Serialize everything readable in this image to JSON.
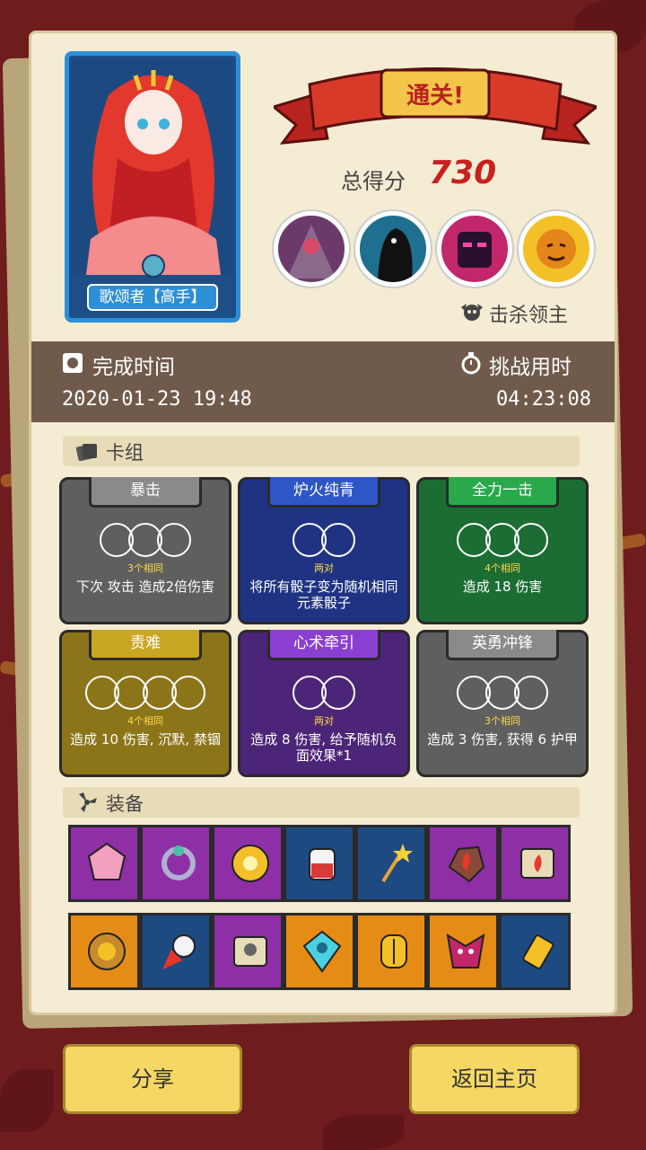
{
  "hero": {
    "name": "歌颂者【高手】"
  },
  "banner": {
    "title": "通关!"
  },
  "score": {
    "label": "总得分",
    "value": "730"
  },
  "bosses": {
    "label": "击杀领主"
  },
  "time": {
    "completed_label": "完成时间",
    "completed_value": "2020-01-23 19:48",
    "duration_label": "挑战用时",
    "duration_value": "04:23:08"
  },
  "deck": {
    "title": "卡组",
    "cards": [
      {
        "name": "暴击",
        "sub": "3个相同",
        "desc": "下次 攻击 造成2倍伤害",
        "color": "#5f5f5f",
        "tab": "#8a8a8a",
        "dice": 3
      },
      {
        "name": "炉火纯青",
        "sub": "两对",
        "desc": "将所有骰子变为随机相同元素骰子",
        "color": "#1f3382",
        "tab": "#2f56c6",
        "dice": 2
      },
      {
        "name": "全力一击",
        "sub": "4个相同",
        "desc": "造成 18 伤害",
        "color": "#1b6d34",
        "tab": "#29a84c",
        "dice": 3
      },
      {
        "name": "责难",
        "sub": "4个相同",
        "desc": "造成 10 伤害, 沉默, 禁锢",
        "color": "#8c7519",
        "tab": "#c9a623",
        "dice": 4
      },
      {
        "name": "心术牵引",
        "sub": "两对",
        "desc": "造成 8 伤害, 给予随机负面效果*1",
        "color": "#4c2578",
        "tab": "#8a3fd0",
        "dice": 2
      },
      {
        "name": "英勇冲锋",
        "sub": "3个相同",
        "desc": "造成 3 伤害, 获得 6 护甲",
        "color": "#5f5f5f",
        "tab": "#8a8a8a",
        "dice": 3
      }
    ]
  },
  "equipment": {
    "title": "装备",
    "row1": [
      {
        "icon": "gem-icon",
        "bg": "#8e2fa6"
      },
      {
        "icon": "ring-icon",
        "bg": "#8e2fa6"
      },
      {
        "icon": "gold-medallion-icon",
        "bg": "#8e2fa6"
      },
      {
        "icon": "potion-jar-icon",
        "bg": "#1e4a82"
      },
      {
        "icon": "star-wand-icon",
        "bg": "#1e4a82"
      },
      {
        "icon": "fire-rock-icon",
        "bg": "#8e2fa6"
      },
      {
        "icon": "fire-scroll-icon",
        "bg": "#8e2fa6"
      }
    ],
    "row2": [
      {
        "icon": "lion-ring-icon",
        "bg": "#e58c16"
      },
      {
        "icon": "skull-rocket-icon",
        "bg": "#1e4a82"
      },
      {
        "icon": "skull-scroll-icon",
        "bg": "#8e2fa6"
      },
      {
        "icon": "crystal-skull-icon",
        "bg": "#e58c16"
      },
      {
        "icon": "golden-helmet-icon",
        "bg": "#e58c16"
      },
      {
        "icon": "demon-mask-icon",
        "bg": "#e58c16"
      },
      {
        "icon": "talisman-icon",
        "bg": "#1e4a82"
      }
    ]
  },
  "buttons": {
    "share": "分享",
    "home": "返回主页"
  }
}
